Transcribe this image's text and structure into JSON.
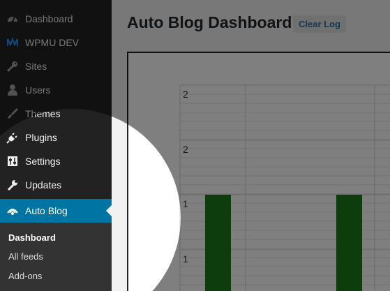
{
  "sidebar": {
    "items": [
      {
        "label": "Dashboard",
        "icon": "dashboard-icon"
      },
      {
        "label": "WPMU DEV",
        "icon": "wpmudev-icon"
      },
      {
        "label": "Sites",
        "icon": "key-icon"
      },
      {
        "label": "Users",
        "icon": "user-icon"
      },
      {
        "label": "Themes",
        "icon": "brush-icon"
      },
      {
        "label": "Plugins",
        "icon": "plug-icon"
      },
      {
        "label": "Settings",
        "icon": "sliders-icon"
      },
      {
        "label": "Updates",
        "icon": "wrench-icon"
      },
      {
        "label": "Auto Blog",
        "icon": "autoblog-icon",
        "active": true
      }
    ],
    "submenu": [
      {
        "label": "Dashboard",
        "current": true
      },
      {
        "label": "All feeds"
      },
      {
        "label": "Add-ons"
      }
    ]
  },
  "header": {
    "title": "Auto Blog Dashboard",
    "clear_log_label": "Clear Log"
  },
  "chart_data": {
    "type": "bar",
    "ytick_labels": [
      "2",
      "2",
      "1",
      "1"
    ],
    "values": [
      1,
      1
    ],
    "colors": [
      "#1b7a1b",
      "#1b7a1b"
    ]
  },
  "colors": {
    "sidebar_bg": "#222222",
    "active_bg": "#0074a2",
    "bar": "#1b7a1b",
    "overlay": "#000000"
  }
}
